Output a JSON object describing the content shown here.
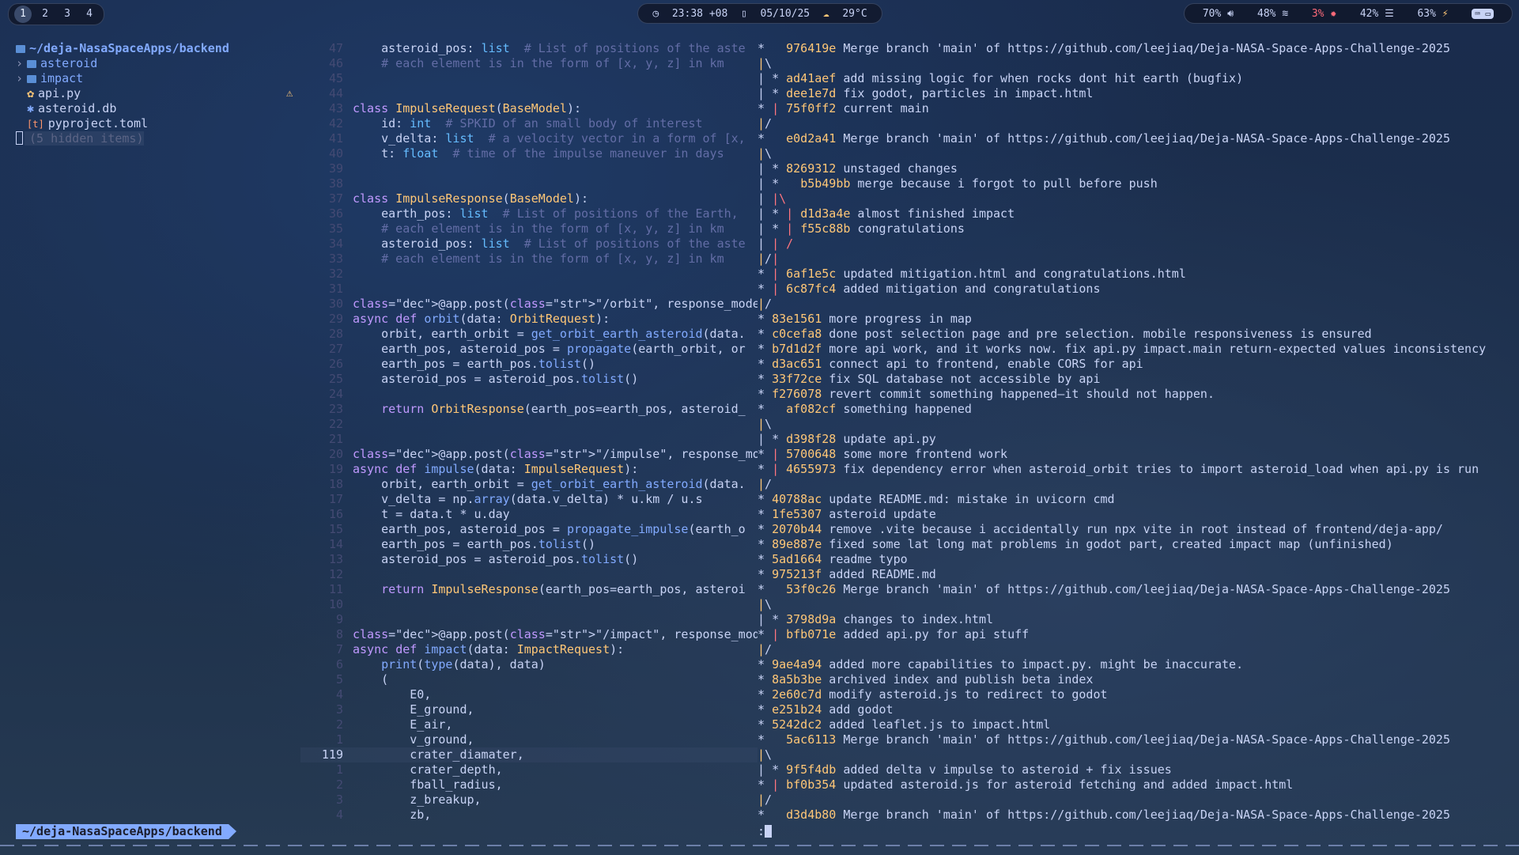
{
  "topbar": {
    "workspaces": [
      "1",
      "2",
      "3",
      "4"
    ],
    "active_workspace": 0,
    "clock": {
      "time": "23:38 +08",
      "date": "05/10/25",
      "weather": "29°C"
    },
    "status": {
      "volume": "70%",
      "wifi": "48%",
      "cpu": "3%",
      "mem": "42%",
      "battery": "63%"
    }
  },
  "tree": {
    "root": "~/deja-NasaSpaceApps/backend",
    "items": [
      {
        "name": "asteroid",
        "kind": "dir"
      },
      {
        "name": "impact",
        "kind": "dir"
      },
      {
        "name": "api.py",
        "kind": "py"
      },
      {
        "name": "asteroid.db",
        "kind": "db"
      },
      {
        "name": "pyproject.toml",
        "kind": "toml"
      },
      {
        "name": "(5 hidden items)",
        "kind": "hidden"
      }
    ]
  },
  "editor": {
    "lines": [
      {
        "n": "47",
        "c": "    asteroid_pos: list  # List of positions of the aste"
      },
      {
        "n": "46",
        "c": "    # each element is in the form of [x, y, z] in km"
      },
      {
        "n": "45",
        "c": ""
      },
      {
        "n": "44",
        "c": ""
      },
      {
        "n": "43",
        "c": "class ImpulseRequest(BaseModel):"
      },
      {
        "n": "42",
        "c": "    id: int  # SPKID of an small body of interest"
      },
      {
        "n": "41",
        "c": "    v_delta: list  # a velocity vector in a form of [x,"
      },
      {
        "n": "40",
        "c": "    t: float  # time of the impulse maneuver in days"
      },
      {
        "n": "39",
        "c": ""
      },
      {
        "n": "38",
        "c": ""
      },
      {
        "n": "37",
        "c": "class ImpulseResponse(BaseModel):"
      },
      {
        "n": "36",
        "c": "    earth_pos: list  # List of positions of the Earth,"
      },
      {
        "n": "35",
        "c": "    # each element is in the form of [x, y, z] in km"
      },
      {
        "n": "34",
        "c": "    asteroid_pos: list  # List of positions of the aste"
      },
      {
        "n": "33",
        "c": "    # each element is in the form of [x, y, z] in km"
      },
      {
        "n": "32",
        "c": ""
      },
      {
        "n": "31",
        "c": ""
      },
      {
        "n": "30",
        "c": "@app.post(\"/orbit\", response_model=OrbitResponse)"
      },
      {
        "n": "29",
        "c": "async def orbit(data: OrbitRequest):"
      },
      {
        "n": "28",
        "c": "    orbit, earth_orbit = get_orbit_earth_asteroid(data."
      },
      {
        "n": "27",
        "c": "    earth_pos, asteroid_pos = propagate(earth_orbit, or"
      },
      {
        "n": "26",
        "c": "    earth_pos = earth_pos.tolist()"
      },
      {
        "n": "25",
        "c": "    asteroid_pos = asteroid_pos.tolist()"
      },
      {
        "n": "24",
        "c": ""
      },
      {
        "n": "23",
        "c": "    return OrbitResponse(earth_pos=earth_pos, asteroid_"
      },
      {
        "n": "22",
        "c": ""
      },
      {
        "n": "21",
        "c": ""
      },
      {
        "n": "20",
        "c": "@app.post(\"/impulse\", response_model=ImpulseResponse)"
      },
      {
        "n": "19",
        "c": "async def impulse(data: ImpulseRequest):"
      },
      {
        "n": "18",
        "c": "    orbit, earth_orbit = get_orbit_earth_asteroid(data."
      },
      {
        "n": "17",
        "c": "    v_delta = np.array(data.v_delta) * u.km / u.s"
      },
      {
        "n": "16",
        "c": "    t = data.t * u.day"
      },
      {
        "n": "15",
        "c": "    earth_pos, asteroid_pos = propagate_impulse(earth_o"
      },
      {
        "n": "14",
        "c": "    earth_pos = earth_pos.tolist()"
      },
      {
        "n": "13",
        "c": "    asteroid_pos = asteroid_pos.tolist()"
      },
      {
        "n": "12",
        "c": ""
      },
      {
        "n": "11",
        "c": "    return ImpulseResponse(earth_pos=earth_pos, asteroi"
      },
      {
        "n": "10",
        "c": ""
      },
      {
        "n": "9",
        "c": ""
      },
      {
        "n": "8",
        "c": "@app.post(\"/impact\", response_model=ImpactResponse)"
      },
      {
        "n": "7",
        "c": "async def impact(data: ImpactRequest):"
      },
      {
        "n": "6",
        "c": "    print(type(data), data)"
      },
      {
        "n": "5",
        "c": "    ("
      },
      {
        "n": "4",
        "c": "        E0,"
      },
      {
        "n": "3",
        "c": "        E_ground,"
      },
      {
        "n": "2",
        "c": "        E_air,"
      },
      {
        "n": "1",
        "c": "        v_ground,"
      },
      {
        "n": "119",
        "c": "        crater_diamater,",
        "current": true
      },
      {
        "n": "1",
        "c": "        crater_depth,"
      },
      {
        "n": "2",
        "c": "        fball_radius,"
      },
      {
        "n": "3",
        "c": "        z_breakup,"
      },
      {
        "n": "4",
        "c": "        zb,"
      }
    ]
  },
  "gitlog": [
    {
      "g": "*   ",
      "h": "976419e",
      "m": " Merge branch 'main' of https://github.com/leejiaq/Deja-NASA-Space-Apps-Challenge-2025"
    },
    {
      "g": "|\\",
      "h": "",
      "m": ""
    },
    {
      "g": "| * ",
      "h": "ad41aef",
      "m": " add missing logic for when rocks dont hit earth (bugfix)"
    },
    {
      "g": "| * ",
      "h": "dee1e7d",
      "m": " fix godot, particles in impact.html"
    },
    {
      "g": "* | ",
      "h": "75f0ff2",
      "m": " current main"
    },
    {
      "g": "|/",
      "h": "",
      "m": ""
    },
    {
      "g": "*   ",
      "h": "e0d2a41",
      "m": " Merge branch 'main' of https://github.com/leejiaq/Deja-NASA-Space-Apps-Challenge-2025"
    },
    {
      "g": "|\\",
      "h": "",
      "m": ""
    },
    {
      "g": "| * ",
      "h": "8269312",
      "m": " unstaged changes"
    },
    {
      "g": "| *   ",
      "h": "b5b49bb",
      "m": " merge because i forgot to pull before push"
    },
    {
      "g": "| |\\",
      "h": "",
      "m": ""
    },
    {
      "g": "| * | ",
      "h": "d1d3a4e",
      "m": " almost finished impact"
    },
    {
      "g": "| * | ",
      "h": "f55c88b",
      "m": " congratulations"
    },
    {
      "g": "| | /",
      "h": "",
      "m": ""
    },
    {
      "g": "|/|",
      "h": "",
      "m": ""
    },
    {
      "g": "* | ",
      "h": "6af1e5c",
      "m": " updated mitigation.html and congratulations.html"
    },
    {
      "g": "* | ",
      "h": "6c87fc4",
      "m": " added mitigation and congratulations"
    },
    {
      "g": "|/",
      "h": "",
      "m": ""
    },
    {
      "g": "* ",
      "h": "83e1561",
      "m": " more progress in map"
    },
    {
      "g": "* ",
      "h": "c0cefa8",
      "m": " done post selection page and pre selection. mobile responsiveness is ensured"
    },
    {
      "g": "* ",
      "h": "b7d1d2f",
      "m": " more api work, and it works now. fix api.py impact.main return-expected values inconsistency"
    },
    {
      "g": "* ",
      "h": "d3ac651",
      "m": " connect api to frontend, enable CORS for api"
    },
    {
      "g": "* ",
      "h": "33f72ce",
      "m": " fix SQL database not accessible by api"
    },
    {
      "g": "* ",
      "h": "f276078",
      "m": " revert commit something happened—it should not happen."
    },
    {
      "g": "*   ",
      "h": "af082cf",
      "m": " something happened"
    },
    {
      "g": "|\\",
      "h": "",
      "m": ""
    },
    {
      "g": "| * ",
      "h": "d398f28",
      "m": " update api.py"
    },
    {
      "g": "* | ",
      "h": "5700648",
      "m": " some more frontend work"
    },
    {
      "g": "* | ",
      "h": "4655973",
      "m": " fix dependency error when asteroid_orbit tries to import asteroid_load when api.py is run"
    },
    {
      "g": "|/",
      "h": "",
      "m": ""
    },
    {
      "g": "* ",
      "h": "40788ac",
      "m": " update README.md: mistake in uvicorn cmd"
    },
    {
      "g": "* ",
      "h": "1fe5307",
      "m": " asteroid update"
    },
    {
      "g": "* ",
      "h": "2070b44",
      "m": " remove .vite because i accidentally run npx vite in root instead of frontend/deja-app/"
    },
    {
      "g": "* ",
      "h": "89e887e",
      "m": " fixed some lat long mat problems in godot part, created impact map (unfinished)"
    },
    {
      "g": "* ",
      "h": "5ad1664",
      "m": " readme typo"
    },
    {
      "g": "* ",
      "h": "975213f",
      "m": " added README.md"
    },
    {
      "g": "*   ",
      "h": "53f0c26",
      "m": " Merge branch 'main' of https://github.com/leejiaq/Deja-NASA-Space-Apps-Challenge-2025"
    },
    {
      "g": "|\\",
      "h": "",
      "m": ""
    },
    {
      "g": "| * ",
      "h": "3798d9a",
      "m": " changes to index.html"
    },
    {
      "g": "* | ",
      "h": "bfb071e",
      "m": " added api.py for api stuff"
    },
    {
      "g": "|/",
      "h": "",
      "m": ""
    },
    {
      "g": "* ",
      "h": "9ae4a94",
      "m": " added more capabilities to impact.py. might be inaccurate."
    },
    {
      "g": "* ",
      "h": "8a5b3be",
      "m": " archived index and publish beta index"
    },
    {
      "g": "* ",
      "h": "2e60c7d",
      "m": " modify asteroid.js to redirect to godot"
    },
    {
      "g": "* ",
      "h": "e251b24",
      "m": " add godot"
    },
    {
      "g": "* ",
      "h": "5242dc2",
      "m": " added leaflet.js to impact.html"
    },
    {
      "g": "*   ",
      "h": "5ac6113",
      "m": " Merge branch 'main' of https://github.com/leejiaq/Deja-NASA-Space-Apps-Challenge-2025"
    },
    {
      "g": "|\\",
      "h": "",
      "m": ""
    },
    {
      "g": "| * ",
      "h": "9f5f4db",
      "m": " added delta v impulse to asteroid + fix issues"
    },
    {
      "g": "* | ",
      "h": "bf0b354",
      "m": " updated asteroid.js for asteroid fetching and added impact.html"
    },
    {
      "g": "|/",
      "h": "",
      "m": ""
    },
    {
      "g": "*   ",
      "h": "d3d4b80",
      "m": " Merge branch 'main' of https://github.com/leejiaq/Deja-NASA-Space-Apps-Challenge-2025"
    }
  ],
  "statusline": {
    "path": "~/deja-NasaSpaceApps/backend",
    "prompt": ":"
  }
}
